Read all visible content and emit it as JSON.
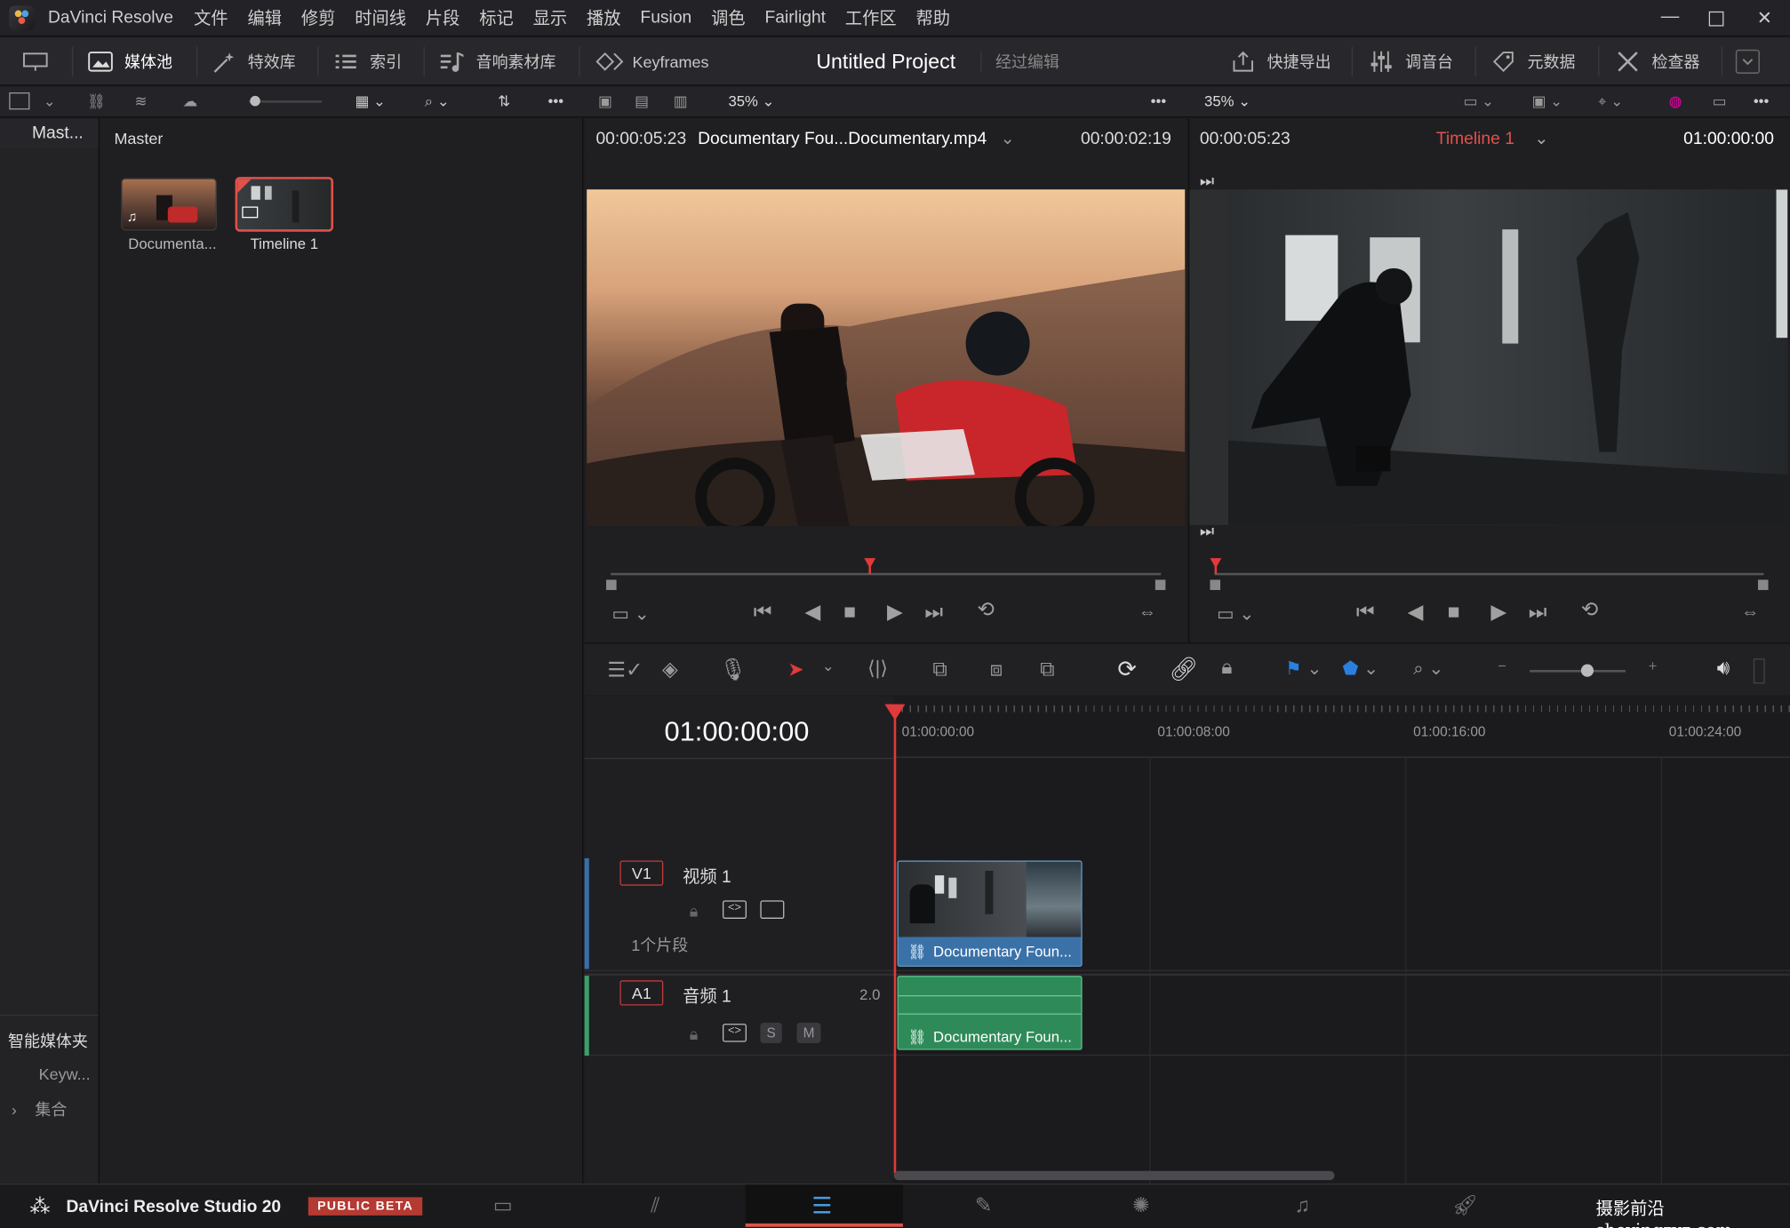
{
  "app": {
    "name": "DaVinci Resolve"
  },
  "menu": [
    "文件",
    "编辑",
    "修剪",
    "时间线",
    "片段",
    "标记",
    "显示",
    "播放",
    "Fusion",
    "调色",
    "Fairlight",
    "工作区",
    "帮助"
  ],
  "toolbar": {
    "media_pool": "媒体池",
    "effects": "特效库",
    "index": "索引",
    "sound_library": "音响素材库",
    "keyframes": "Keyframes",
    "project_title": "Untitled Project",
    "project_status": "经过编辑",
    "quick_export": "快捷导出",
    "mixer": "调音台",
    "metadata": "元数据",
    "inspector": "检查器"
  },
  "subbar": {
    "zoom_left": "35%",
    "zoom_right": "35%"
  },
  "sidebar": {
    "bin": "Mast...",
    "smart_bins": "智能媒体夹",
    "keywords": "Keyw...",
    "collections": "集合"
  },
  "pool": {
    "header": "Master",
    "items": [
      {
        "label": "Documenta..."
      },
      {
        "label": "Timeline 1"
      }
    ]
  },
  "source_viewer": {
    "timecode": "00:00:05:23",
    "clip_name": "Documentary Fou...Documentary.mp4",
    "duration": "00:00:02:19"
  },
  "timeline_viewer": {
    "timecode": "00:00:05:23",
    "timeline_name": "Timeline 1",
    "position": "01:00:00:00"
  },
  "timeline": {
    "current_tc": "01:00:00:00",
    "ruler": [
      "01:00:00:00",
      "01:00:08:00",
      "01:00:16:00",
      "01:00:24:00"
    ],
    "video_track": {
      "tag": "V1",
      "name": "视频 1",
      "info": "1个片段"
    },
    "audio_track": {
      "tag": "A1",
      "name": "音频 1",
      "channels": "2.0",
      "solo": "S",
      "mute": "M"
    },
    "video_clip": "Documentary Foun...",
    "audio_clip": "Documentary Foun..."
  },
  "bottom": {
    "product": "DaVinci Resolve Studio 20",
    "badge": "PUBLIC BETA",
    "watermark": "摄影前沿 sheyingzyz.com"
  }
}
